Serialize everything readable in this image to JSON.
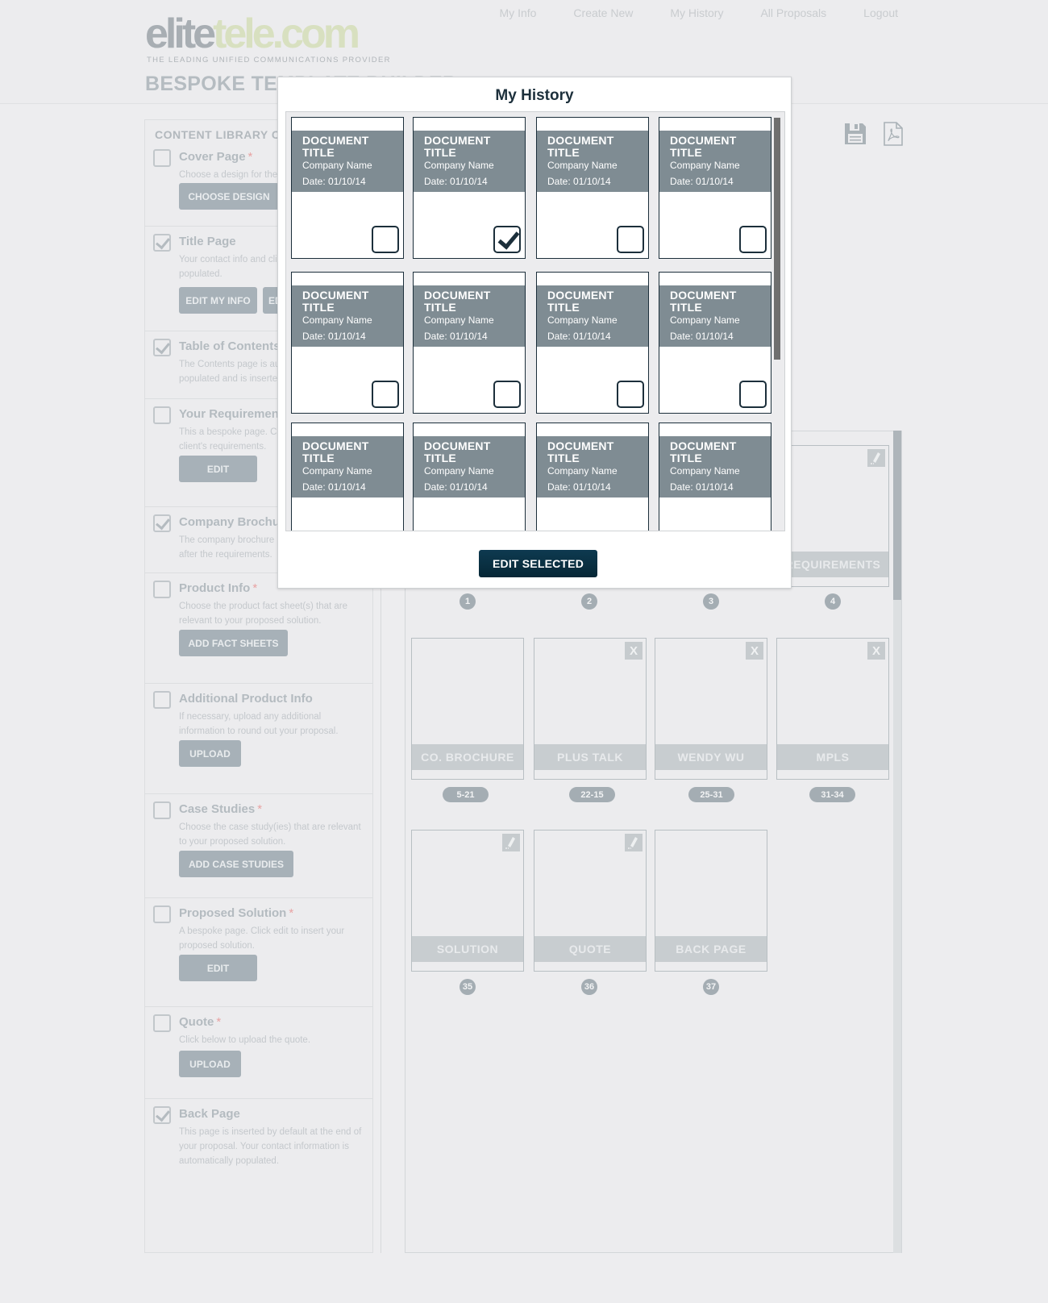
{
  "logo": {
    "part1": "elite",
    "part2": "tele",
    "part3": ".com",
    "tagline": "THE LEADING UNIFIED COMMUNICATIONS PROVIDER"
  },
  "page_title": "BESPOKE TEMPLATE BUILDER",
  "nav": [
    "My Info",
    "Create New",
    "My History",
    "All Proposals",
    "Logout"
  ],
  "content_library": {
    "title": "CONTENT LIBRARY CATEGORIES",
    "items": [
      {
        "title": "Cover Page",
        "required": "*",
        "checked": false,
        "desc": "Choose a design for the cover page.",
        "buttons": [
          "CHOOSE DESIGN"
        ]
      },
      {
        "title": "Title Page",
        "required": "",
        "checked": true,
        "desc": "Your contact info and client info will be auto populated.",
        "buttons": [
          "EDIT MY INFO",
          "EDIT CLIENT INFO"
        ]
      },
      {
        "title": "Table of Contents",
        "required": "",
        "checked": true,
        "desc": "The Contents page is automatically populated and is inserted by default.",
        "buttons": []
      },
      {
        "title": "Your Requirements",
        "required": "",
        "checked": false,
        "desc": "This a bespoke page. Click edit to insert your client's requirements.",
        "buttons": [
          "EDIT"
        ]
      },
      {
        "title": "Company Brochure",
        "required": "",
        "checked": true,
        "desc": "The company brochure is inserted and added after the requirements.",
        "buttons": []
      },
      {
        "title": "Product Info",
        "required": "*",
        "checked": false,
        "desc": "Choose the product fact sheet(s) that are relevant to your proposed solution.",
        "buttons": [
          "ADD FACT SHEETS"
        ]
      },
      {
        "title": "Additional Product Info",
        "required": "",
        "checked": false,
        "desc": "If necessary, upload any additional information to round out your proposal.",
        "buttons": [
          "UPLOAD"
        ]
      },
      {
        "title": "Case Studies",
        "required": "*",
        "checked": false,
        "desc": "Choose the case study(ies) that are relevant to your proposed solution.",
        "buttons": [
          "ADD CASE STUDIES"
        ]
      },
      {
        "title": "Proposed Solution",
        "required": "*",
        "checked": false,
        "desc": "A bespoke page. Click edit to insert your proposed solution.",
        "buttons": [
          "EDIT"
        ]
      },
      {
        "title": "Quote",
        "required": "*",
        "checked": false,
        "desc": "Click below to upload the quote.",
        "buttons": [
          "UPLOAD"
        ]
      },
      {
        "title": "Back Page",
        "required": "",
        "checked": true,
        "desc": "This page is inserted by default at the end of your proposal. Your contact information is automatically populated.",
        "buttons": []
      }
    ]
  },
  "toolbar": {
    "save_icon": "floppy-disk-icon",
    "pdf_icon": "pdf-document-icon"
  },
  "pages": {
    "row1": [
      {
        "label": "REQUIREMENTS",
        "num": "4",
        "action": "edit"
      }
    ],
    "row1_nums": [
      "1",
      "2",
      "3",
      "4"
    ],
    "row2": [
      {
        "label": "CO. BROCHURE",
        "range": "5-21",
        "action": ""
      },
      {
        "label": "PLUS TALK",
        "range": "22-15",
        "action": "X"
      },
      {
        "label": "WENDY WU",
        "range": "25-31",
        "action": "X"
      },
      {
        "label": "MPLS",
        "range": "31-34",
        "action": "X"
      }
    ],
    "row3": [
      {
        "label": "SOLUTION",
        "num": "35",
        "action": "edit"
      },
      {
        "label": "QUOTE",
        "num": "36",
        "action": "edit"
      },
      {
        "label": "BACK PAGE",
        "num": "37",
        "action": ""
      }
    ]
  },
  "modal": {
    "title": "My History",
    "documents": [
      {
        "title": "DOCUMENT TITLE",
        "company": "Company Name",
        "date": "Date: 01/10/14",
        "selected": false
      },
      {
        "title": "DOCUMENT TITLE",
        "company": "Company Name",
        "date": "Date: 01/10/14",
        "selected": true
      },
      {
        "title": "DOCUMENT TITLE",
        "company": "Company Name",
        "date": "Date: 01/10/14",
        "selected": false
      },
      {
        "title": "DOCUMENT TITLE",
        "company": "Company Name",
        "date": "Date: 01/10/14",
        "selected": false
      },
      {
        "title": "DOCUMENT TITLE",
        "company": "Company Name",
        "date": "Date: 01/10/14",
        "selected": false
      },
      {
        "title": "DOCUMENT TITLE",
        "company": "Company Name",
        "date": "Date: 01/10/14",
        "selected": false
      },
      {
        "title": "DOCUMENT TITLE",
        "company": "Company Name",
        "date": "Date: 01/10/14",
        "selected": false
      },
      {
        "title": "DOCUMENT TITLE",
        "company": "Company Name",
        "date": "Date: 01/10/14",
        "selected": false
      },
      {
        "title": "DOCUMENT TITLE",
        "company": "Company Name",
        "date": "Date: 01/10/14",
        "selected": false
      },
      {
        "title": "DOCUMENT TITLE",
        "company": "Company Name",
        "date": "Date: 01/10/14",
        "selected": false
      },
      {
        "title": "DOCUMENT TITLE",
        "company": "Company Name",
        "date": "Date: 01/10/14",
        "selected": false
      },
      {
        "title": "DOCUMENT TITLE",
        "company": "Company Name",
        "date": "Date: 01/10/14",
        "selected": false
      }
    ],
    "edit_selected_label": "EDIT SELECTED"
  }
}
